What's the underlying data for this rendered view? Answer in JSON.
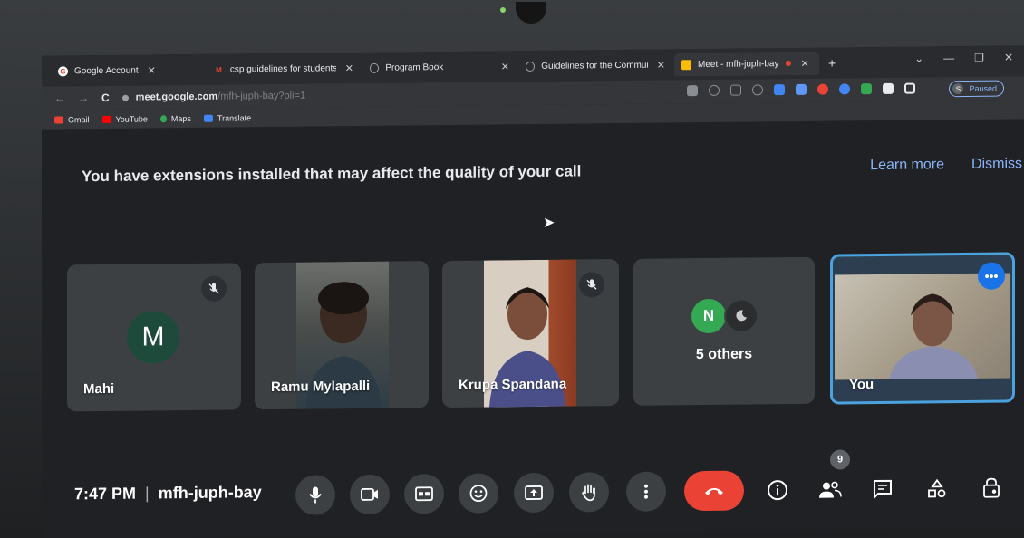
{
  "browser": {
    "tabs": [
      {
        "title": "Google Account",
        "icon": "google-icon",
        "color": "#ea4335"
      },
      {
        "title": "csp guidelines for students",
        "icon": "gmail-icon",
        "color": "#ea4335"
      },
      {
        "title": "Program Book",
        "icon": "globe-icon",
        "color": "#9aa0a6"
      },
      {
        "title": "Guidelines for the Commun",
        "icon": "globe-icon",
        "color": "#9aa0a6"
      },
      {
        "title": "Meet - mfh-juph-bay",
        "icon": "meet-icon",
        "color": "#fbbc04"
      }
    ],
    "close_glyph": "✕",
    "new_tab_glyph": "+",
    "url_host": "meet.google.com",
    "url_path": "/mfh-juph-bay?pli=1",
    "profile_initial": "S",
    "profile_status": "Paused",
    "bookmarks": [
      {
        "label": "Gmail",
        "color": "#ea4335"
      },
      {
        "label": "YouTube",
        "color": "#ff0000"
      },
      {
        "label": "Maps",
        "color": "#34a853"
      },
      {
        "label": "Translate",
        "color": "#4285f4"
      }
    ]
  },
  "banner": {
    "message": "You have extensions installed that may affect the quality of your call",
    "learn_more": "Learn more",
    "dismiss": "Dismiss"
  },
  "participants": {
    "mahi": {
      "name": "Mahi",
      "initial": "M"
    },
    "ramu": {
      "name": "Ramu Mylapalli"
    },
    "krupa": {
      "name": "Krupa Spandana"
    },
    "others": {
      "label": "5 others",
      "initial": "N"
    },
    "self": {
      "name": "You",
      "more_glyph": "•••"
    }
  },
  "meeting": {
    "time": "7:47 PM",
    "separator": "|",
    "code": "mfh-juph-bay",
    "people_count": "9"
  },
  "colors": {
    "accent": "#1a73e8",
    "end_call": "#ea4335",
    "tile": "#3c4043"
  }
}
